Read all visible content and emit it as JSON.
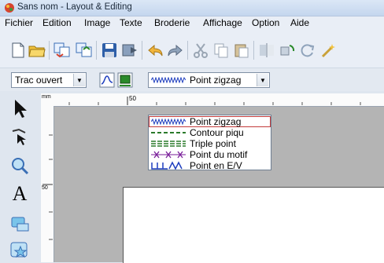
{
  "window": {
    "title": "Sans nom - Layout & Editing"
  },
  "menu": [
    "Fichier",
    "Edition",
    "Image",
    "Texte",
    "Broderie",
    "Affichage",
    "Option",
    "Aide"
  ],
  "toolbar2": {
    "sew_mode": "Trac ouvert",
    "stitch_type": "Point zigzag"
  },
  "ruler": {
    "unit": "mm",
    "h_mark": "50",
    "v_mark": "50"
  },
  "dropdown": {
    "items": [
      {
        "label": "Point zigzag",
        "color": "#1f3fbf"
      },
      {
        "label": "Contour piqu",
        "color": "#2a7a2a"
      },
      {
        "label": "Triple point",
        "color": "#2a7a2a"
      },
      {
        "label": "Point du motif",
        "color": "#7a1f9a"
      },
      {
        "label": "Point en E/V",
        "color": "#1f3fbf"
      }
    ],
    "selected_index": 0
  }
}
